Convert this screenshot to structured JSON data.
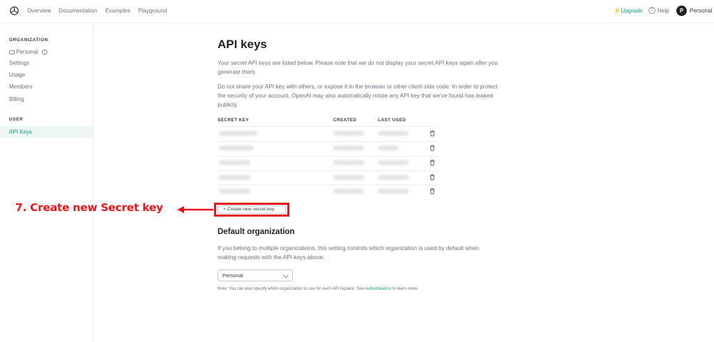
{
  "header": {
    "nav": [
      "Overview",
      "Documentation",
      "Examples",
      "Playground"
    ],
    "upgrade_label": "Upgrade",
    "help_label": "Help",
    "avatar_initial": "P",
    "account_label": "Personal"
  },
  "sidebar": {
    "organization_heading": "ORGANIZATION",
    "org_items": [
      "Personal",
      "Settings",
      "Usage",
      "Members",
      "Billing"
    ],
    "user_heading": "USER",
    "active_item": "API Keys"
  },
  "main": {
    "title": "API keys",
    "intro": "Your secret API keys are listed below. Please note that we do not display your secret API keys again after you generate them.",
    "warning": "Do not share your API key with others, or expose it in the browser or other client-side code. In order to protect the security of your account, OpenAI may also automatically rotate any API key that we've found has leaked publicly.",
    "table_headers": [
      "SECRET KEY",
      "CREATED",
      "LAST USED"
    ],
    "row_count": 5,
    "create_button_label": "+ Create new secret key",
    "default_org_heading": "Default organization",
    "default_org_text": "If you belong to multiple organizations, this setting controls which organization is used by default when making requests with the API keys above.",
    "select_value": "Personal",
    "note_prefix": "Note: You can also specify which organization to use for each API request. See ",
    "note_link": "Authentication",
    "note_suffix": " to learn more."
  },
  "annotation": {
    "text": "7. Create new Secret key",
    "color": "#e8141c"
  },
  "colors": {
    "accent": "#10a37f",
    "highlight": "#e8141c"
  }
}
